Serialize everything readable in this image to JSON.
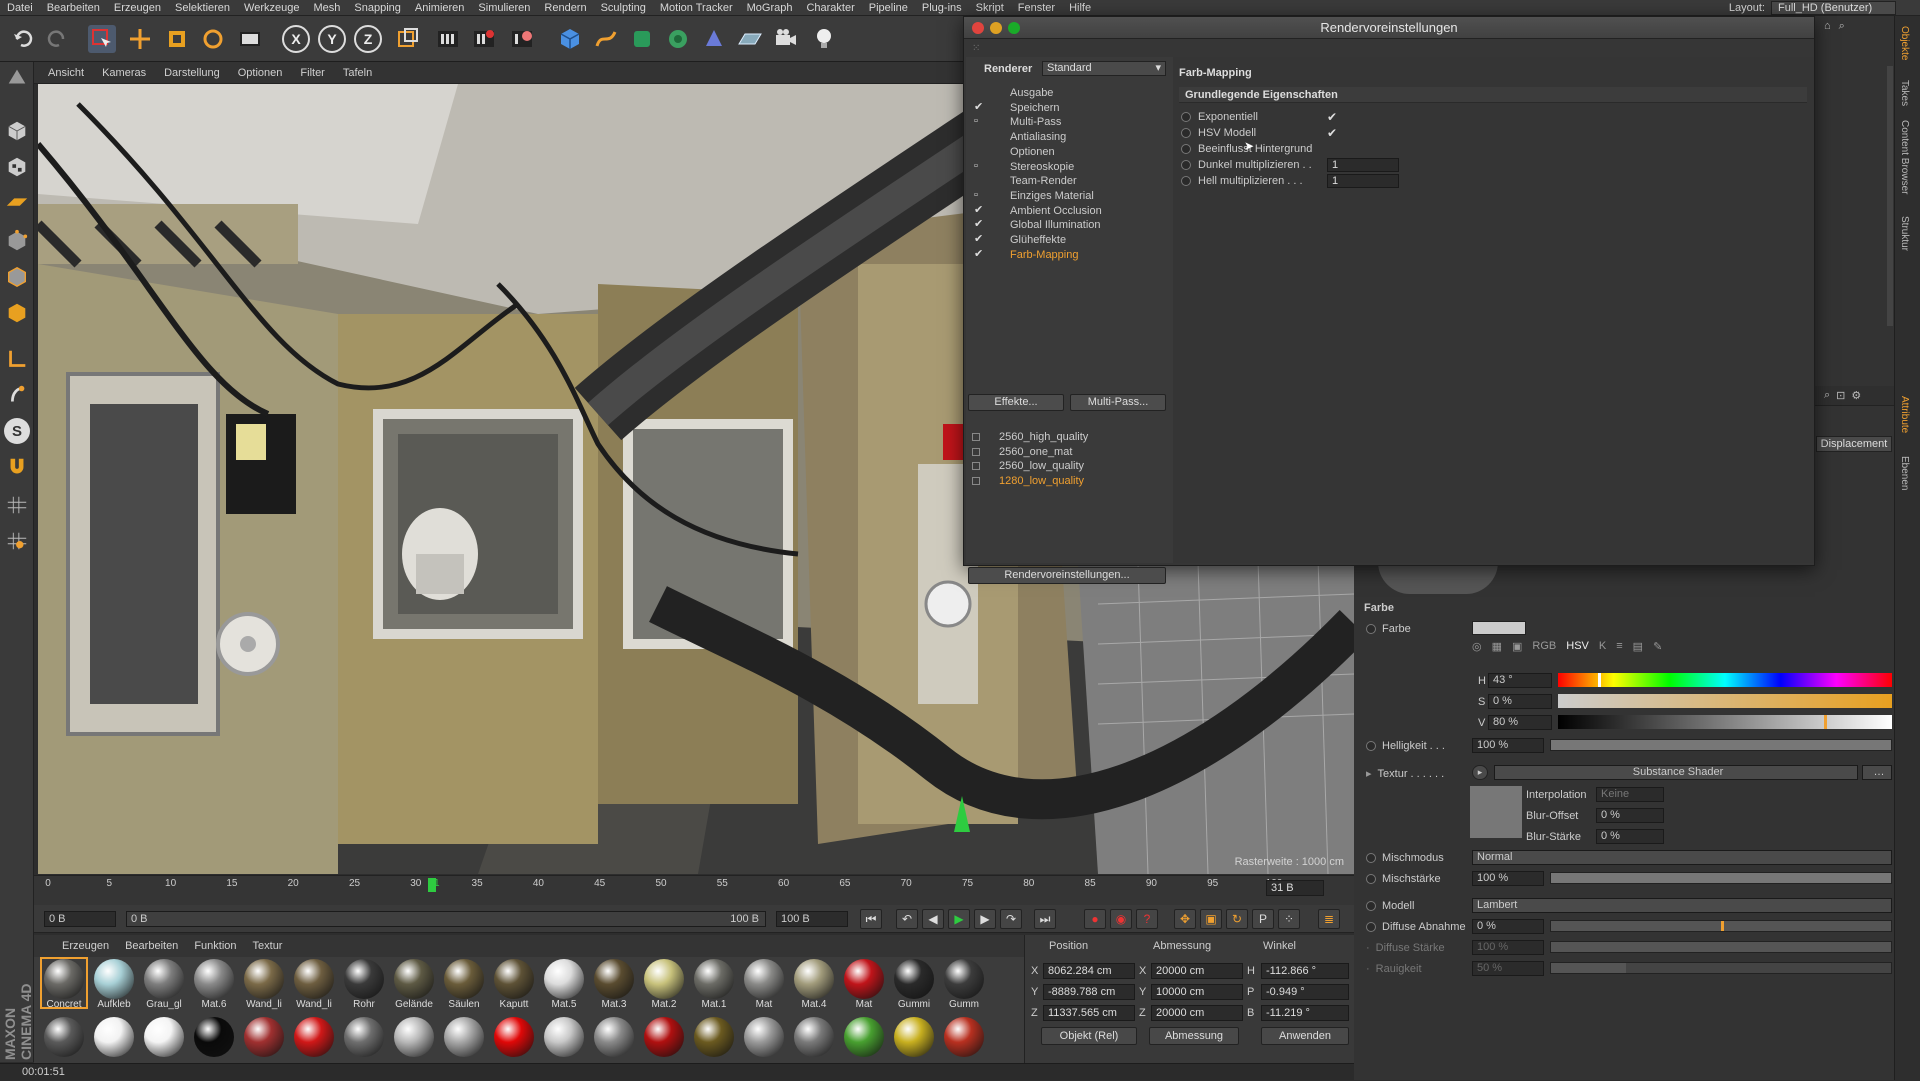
{
  "menubar": {
    "items": [
      "Datei",
      "Bearbeiten",
      "Erzeugen",
      "Selektieren",
      "Werkzeuge",
      "Mesh",
      "Snapping",
      "Animieren",
      "Simulieren",
      "Rendern",
      "Sculpting",
      "Motion Tracker",
      "MoGraph",
      "Charakter",
      "Pipeline",
      "Plug-ins",
      "Skript",
      "Fenster",
      "Hilfe"
    ],
    "layout_label": "Layout:",
    "layout_value": "Full_HD (Benutzer)"
  },
  "viewport": {
    "menu": [
      "Ansicht",
      "Kameras",
      "Darstellung",
      "Optionen",
      "Filter",
      "Tafeln"
    ],
    "grid_info": "Rasterweite : 1000 cm"
  },
  "timeline": {
    "ticks": [
      "0",
      "5",
      "10",
      "15",
      "20",
      "25",
      "30",
      "31",
      "35",
      "40",
      "45",
      "50",
      "55",
      "60",
      "65",
      "70",
      "75",
      "80",
      "85",
      "90",
      "95",
      "100"
    ],
    "current_frame_box": "31 B",
    "start_field": "0 B",
    "range_start": "0 B",
    "range_end": "100 B",
    "end_field": "100 B"
  },
  "materials": {
    "menu": [
      "Erzeugen",
      "Bearbeiten",
      "Funktion",
      "Textur"
    ],
    "row1": [
      {
        "name": "Concret",
        "color": "#6b6a66"
      },
      {
        "name": "Aufkleb",
        "color": "#a8d0d6"
      },
      {
        "name": "Grau_gl",
        "color": "#7e7e7e"
      },
      {
        "name": "Mat.6",
        "color": "#8a8a8a"
      },
      {
        "name": "Wand_li",
        "color": "#7b6a48"
      },
      {
        "name": "Wand_li",
        "color": "#6e5e40"
      },
      {
        "name": "Rohr",
        "color": "#3a3a3a"
      },
      {
        "name": "Gelände",
        "color": "#5e5a44"
      },
      {
        "name": "Säulen",
        "color": "#6a5c3a"
      },
      {
        "name": "Kaputt",
        "color": "#5e5236"
      },
      {
        "name": "Mat.5",
        "color": "#dcdcdc"
      },
      {
        "name": "Mat.3",
        "color": "#5a4c30"
      },
      {
        "name": "Mat.2",
        "color": "#c8c27c"
      },
      {
        "name": "Mat.1",
        "color": "#6c6c66"
      },
      {
        "name": "Mat",
        "color": "#8a8a88"
      },
      {
        "name": "Mat.4",
        "color": "#a29c7c"
      },
      {
        "name": "Mat",
        "color": "#c0141a"
      },
      {
        "name": "Gummi",
        "color": "#2a2a2a"
      },
      {
        "name": "Gumm",
        "color": "#3c3c3c"
      }
    ],
    "row2": [
      {
        "color": "#5a5a5a"
      },
      {
        "color": "#f2f2f2"
      },
      {
        "color": "#f4f4f4"
      },
      {
        "color": "#0a0a0a"
      },
      {
        "color": "#a03030"
      },
      {
        "color": "#d01818"
      },
      {
        "color": "#6e6e6e"
      },
      {
        "color": "#b8b8b8"
      },
      {
        "color": "#a8a8a8"
      },
      {
        "color": "#e00808"
      },
      {
        "color": "#c8c8c8"
      },
      {
        "color": "#8a8a8a"
      },
      {
        "color": "#b01010"
      },
      {
        "color": "#6b5a20"
      },
      {
        "color": "#9a9a9a"
      },
      {
        "color": "#7a7a7a"
      },
      {
        "color": "#48a030"
      },
      {
        "color": "#c8b020"
      },
      {
        "color": "#b83020"
      }
    ]
  },
  "coords": {
    "headers": [
      "Position",
      "Abmessung",
      "Winkel"
    ],
    "rows": [
      {
        "axis": "X",
        "pos": "8062.284 cm",
        "size_axis": "X",
        "size": "20000 cm",
        "rot_axis": "H",
        "rot": "-112.866 °"
      },
      {
        "axis": "Y",
        "pos": "-8889.788 cm",
        "size_axis": "Y",
        "size": "10000 cm",
        "rot_axis": "P",
        "rot": "-0.949 °"
      },
      {
        "axis": "Z",
        "pos": "11337.565 cm",
        "size_axis": "Z",
        "size": "20000 cm",
        "rot_axis": "B",
        "rot": "-11.219 °"
      }
    ],
    "mode_select": "Objekt (Rel)",
    "size_select": "Abmessung",
    "apply_button": "Anwenden"
  },
  "status": {
    "time": "00:01:51"
  },
  "branding": {
    "maxon": "MAXON CINEMA 4D"
  },
  "dialog": {
    "title": "Rendervoreinstellungen",
    "renderer_label": "Renderer",
    "renderer_value": "Standard",
    "nav": [
      {
        "label": "Ausgabe",
        "check": ""
      },
      {
        "label": "Speichern",
        "check": "✔"
      },
      {
        "label": "Multi-Pass",
        "check": "▫"
      },
      {
        "label": "Antialiasing",
        "check": ""
      },
      {
        "label": "Optionen",
        "check": ""
      },
      {
        "label": "Stereoskopie",
        "check": "▫"
      },
      {
        "label": "Team-Render",
        "check": ""
      },
      {
        "label": "Einziges Material",
        "check": "▫"
      },
      {
        "label": "Ambient Occlusion",
        "check": "✔"
      },
      {
        "label": "Global Illumination",
        "check": "✔"
      },
      {
        "label": "Glüheffekte",
        "check": "✔"
      },
      {
        "label": "Farb-Mapping",
        "check": "✔",
        "active": true
      }
    ],
    "effects_button": "Effekte...",
    "multipass_button": "Multi-Pass...",
    "presets": [
      {
        "label": "2560_high_quality"
      },
      {
        "label": "2560_one_mat"
      },
      {
        "label": "2560_low_quality"
      },
      {
        "label": "1280_low_quality",
        "active": true
      }
    ],
    "settings_button": "Rendervoreinstellungen...",
    "section_title": "Farb-Mapping",
    "group_title": "Grundlegende Eigenschaften",
    "props": [
      {
        "label": "Exponentiell",
        "value": "✔",
        "type": "check"
      },
      {
        "label": "HSV Modell",
        "value": "✔",
        "type": "check"
      },
      {
        "label": "Beeinflusst Hintergrund",
        "value": "",
        "type": "check"
      },
      {
        "label": "Dunkel multiplizieren . .",
        "value": "1",
        "type": "field"
      },
      {
        "label": "Hell multiplizieren . . .",
        "value": "1",
        "type": "field"
      }
    ]
  },
  "attributes": {
    "displacement_tab": "Displacement",
    "section": "Farbe",
    "farbe_label": "Farbe",
    "h_label": "H",
    "h_value": "43 °",
    "s_label": "S",
    "s_value": "0 %",
    "v_label": "V",
    "v_value": "80 %",
    "helligkeit_label": "Helligkeit . . .",
    "helligkeit_value": "100 %",
    "textur_label": "Textur . . . . . .",
    "textur_value": "Substance Shader",
    "interpolation_label": "Interpolation",
    "interpolation_value": "Keine",
    "bluroffset_label": "Blur-Offset",
    "bluroffset_value": "0 %",
    "blurstaerke_label": "Blur-Stärke",
    "blurstaerke_value": "0 %",
    "mischmodus_label": "Mischmodus",
    "mischmodus_value": "Normal",
    "mischstaerke_label": "Mischstärke",
    "mischstaerke_value": "100 %",
    "modell_label": "Modell",
    "modell_value": "Lambert",
    "diffuse_abnahme_label": "Diffuse Abnahme",
    "diffuse_abnahme_value": "0 %",
    "diffuse_staerke_label": "Diffuse Stärke",
    "diffuse_staerke_value": "100 %",
    "rauigkeit_label": "Rauigkeit",
    "rauigkeit_value": "50 %"
  },
  "right_tabs": [
    "Objekte",
    "Takes",
    "Content Browser",
    "Struktur",
    "Attribute",
    "Ebenen"
  ],
  "colors": {
    "accent_orange": "#f0a030",
    "active_green": "#2ecc40"
  }
}
